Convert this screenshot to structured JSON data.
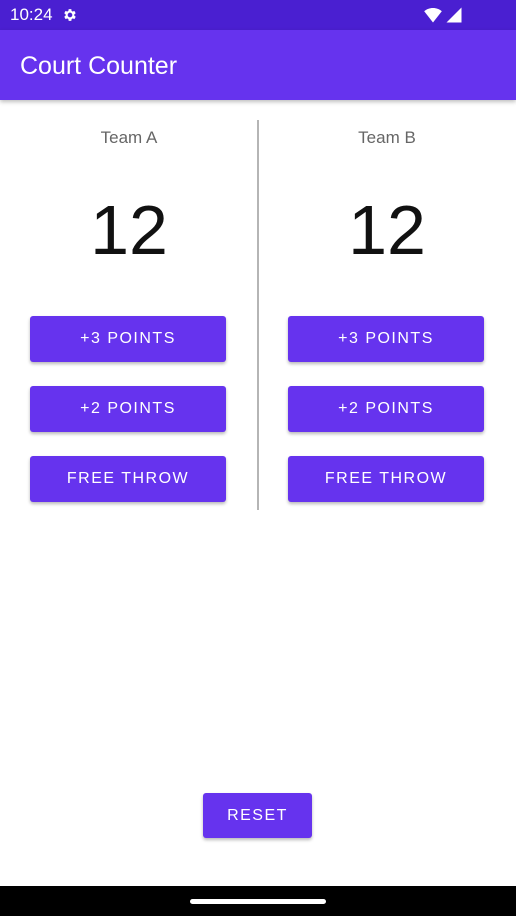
{
  "status_bar": {
    "time": "10:24",
    "icons": [
      "gear-icon",
      "wifi-icon",
      "signal-icon"
    ],
    "background": "#4a1fd1"
  },
  "app_bar": {
    "title": "Court Counter",
    "background": "#6633ee"
  },
  "team_a": {
    "name": "Team A",
    "score": "12",
    "buttons": {
      "three": "+3 POINTS",
      "two": "+2 POINTS",
      "free_throw": "FREE THROW"
    }
  },
  "team_b": {
    "name": "Team B",
    "score": "12",
    "buttons": {
      "three": "+3 POINTS",
      "two": "+2 POINTS",
      "free_throw": "FREE THROW"
    }
  },
  "reset": {
    "label": "RESET"
  },
  "colors": {
    "accent": "#6633ee",
    "status_bar": "#4a1fd1",
    "divider": "#b5b5b5",
    "nav_bar": "#000000"
  }
}
